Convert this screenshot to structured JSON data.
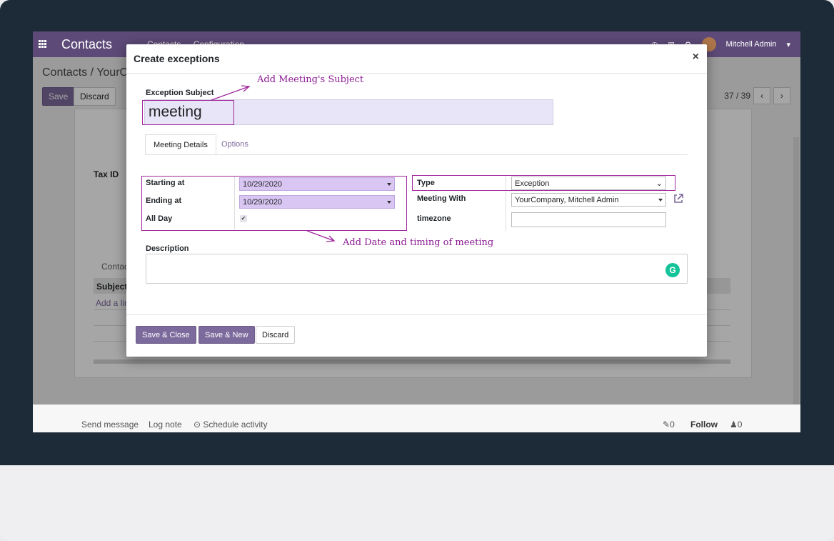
{
  "navbar": {
    "app_title": "Contacts",
    "menu": [
      "Contacts",
      "Configuration"
    ],
    "user_name": "Mitchell Admin"
  },
  "background": {
    "breadcrumb": "Contacts / YourCo",
    "save_label": "Save",
    "discard_label": "Discard",
    "pager": "37 / 39",
    "tax_id_label": "Tax ID",
    "contacts_tab": "Contac",
    "table_subject_header": "Subject",
    "add_line": "Add a line",
    "chatter": {
      "send_message": "Send message",
      "log_note": "Log note",
      "schedule_activity": "Schedule activity",
      "attachments_count": "0",
      "follow": "Follow",
      "followers_count": "0"
    }
  },
  "modal": {
    "title": "Create exceptions",
    "close": "×",
    "subject_label": "Exception Subject",
    "subject_value": "meeting",
    "tabs": [
      "Meeting Details",
      "Options"
    ],
    "starting_at_label": "Starting at",
    "starting_at_value": "10/29/2020",
    "ending_at_label": "Ending at",
    "ending_at_value": "10/29/2020",
    "all_day_label": "All Day",
    "type_label": "Type",
    "type_value": "Exception",
    "meeting_with_label": "Meeting With",
    "meeting_with_value": "YourCompany, Mitchell Admin",
    "timezone_label": "timezone",
    "description_label": "Description",
    "footer": {
      "save_close": "Save & Close",
      "save_new": "Save & New",
      "discard": "Discard"
    }
  },
  "annotations": {
    "subject_note": "Add Meeting's Subject",
    "date_note": "Add Date and timing of meeting",
    "color": "#a0269c"
  },
  "colors": {
    "brand": "#5d4a78",
    "primary_button": "#7c6a9c",
    "required_field": "#d9c6f2"
  }
}
